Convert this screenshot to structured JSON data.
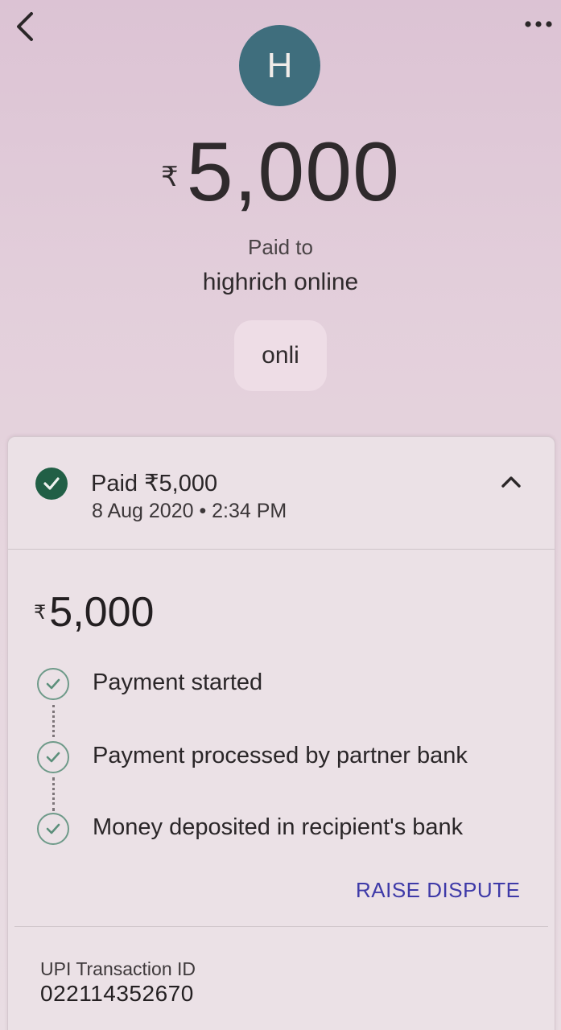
{
  "header": {
    "back_icon": "chevron-left-icon",
    "more_icon": "more-horizontal-icon"
  },
  "payee": {
    "avatar_initial": "H",
    "avatar_color": "#3f6e7d"
  },
  "hero": {
    "currency_symbol": "₹",
    "amount": "5,000",
    "paid_to_label": "Paid to",
    "payee_name": "highrich online",
    "note": "onli"
  },
  "status": {
    "title": "Paid ₹5,000",
    "datetime": "8 Aug 2020 • 2:34 PM",
    "check_color": "#215f46",
    "toggle_icon": "chevron-up-icon"
  },
  "details": {
    "currency_symbol": "₹",
    "amount": "5,000",
    "steps": [
      {
        "label": "Payment started"
      },
      {
        "label": "Payment processed by partner bank"
      },
      {
        "label": "Money deposited in recipient's bank"
      }
    ],
    "raise_dispute_label": "RAISE DISPUTE",
    "link_color": "#3e3aa8"
  },
  "transaction": {
    "id_label": "UPI Transaction ID",
    "id_value": "022114352670"
  }
}
